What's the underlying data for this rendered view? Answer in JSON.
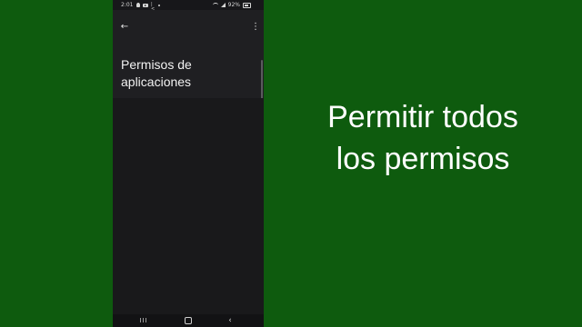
{
  "background_color": "#0e5b0e",
  "status_bar": {
    "time": "2:01",
    "battery": "92%",
    "left_icons": [
      "person-icon",
      "youtube-icon",
      "notification-icon",
      "dot-icon"
    ],
    "right_icons": [
      "wifi-icon",
      "signal-icon",
      "battery-icon"
    ]
  },
  "app_bar": {
    "back_icon": "arrow-left-icon",
    "back_glyph": "←",
    "more_icon": "more-vert-icon",
    "more_glyph": "⋮"
  },
  "screen": {
    "title_line1": "Permisos de",
    "title_line2": "aplicaciones"
  },
  "nav_bar": {
    "recents_glyph": "III",
    "back_glyph": "‹"
  },
  "caption": {
    "line1": "Permitir todos",
    "line2": "los permisos"
  }
}
